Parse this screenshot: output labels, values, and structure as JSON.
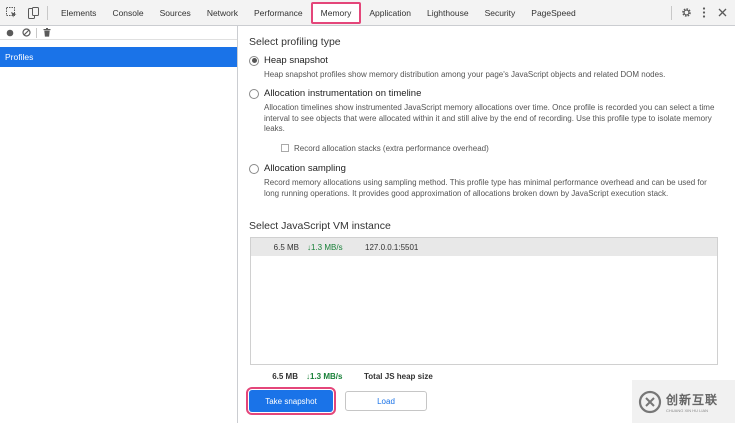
{
  "toolbar": {
    "tabs": [
      "Elements",
      "Console",
      "Sources",
      "Network",
      "Performance",
      "Memory",
      "Application",
      "Lighthouse",
      "Security",
      "PageSpeed"
    ],
    "active_tab": "Memory",
    "icons": [
      "inspect-element-icon",
      "device-toolbar-icon",
      "settings-gear-icon",
      "kebab-menu-icon",
      "close-icon"
    ]
  },
  "sidebar": {
    "icons": [
      "record-icon",
      "clear-icon",
      "garbage-collect-icon"
    ],
    "items": [
      {
        "label": "Profiles"
      }
    ]
  },
  "main": {
    "profiling_title": "Select profiling type",
    "options": [
      {
        "label": "Heap snapshot",
        "checked": true,
        "description": "Heap snapshot profiles show memory distribution among your page's JavaScript objects and related DOM nodes."
      },
      {
        "label": "Allocation instrumentation on timeline",
        "checked": false,
        "description": "Allocation timelines show instrumented JavaScript memory allocations over time. Once profile is recorded you can select a time interval to see objects that were allocated within it and still alive by the end of recording. Use this profile type to isolate memory leaks.",
        "checkbox_label": "Record allocation stacks (extra performance overhead)"
      },
      {
        "label": "Allocation sampling",
        "checked": false,
        "description": "Record memory allocations using sampling method. This profile type has minimal performance overhead and can be used for long running operations. It provides good approximation of allocations broken down by JavaScript execution stack."
      }
    ],
    "vm_title": "Select JavaScript VM instance",
    "vm_instances": [
      {
        "size": "6.5 MB",
        "rate": "1.3 MB/s",
        "target": "127.0.0.1:5501"
      }
    ],
    "total": {
      "size": "6.5 MB",
      "rate": "1.3 MB/s",
      "label": "Total JS heap size"
    },
    "take_snapshot_label": "Take snapshot",
    "load_label": "Load"
  },
  "watermark": {
    "main": "创新互联",
    "sub": "CHUANG XIN HU LIAN"
  },
  "colors": {
    "accent": "#1a73e8",
    "highlight": "#e4467a",
    "rate_green": "#188038"
  }
}
